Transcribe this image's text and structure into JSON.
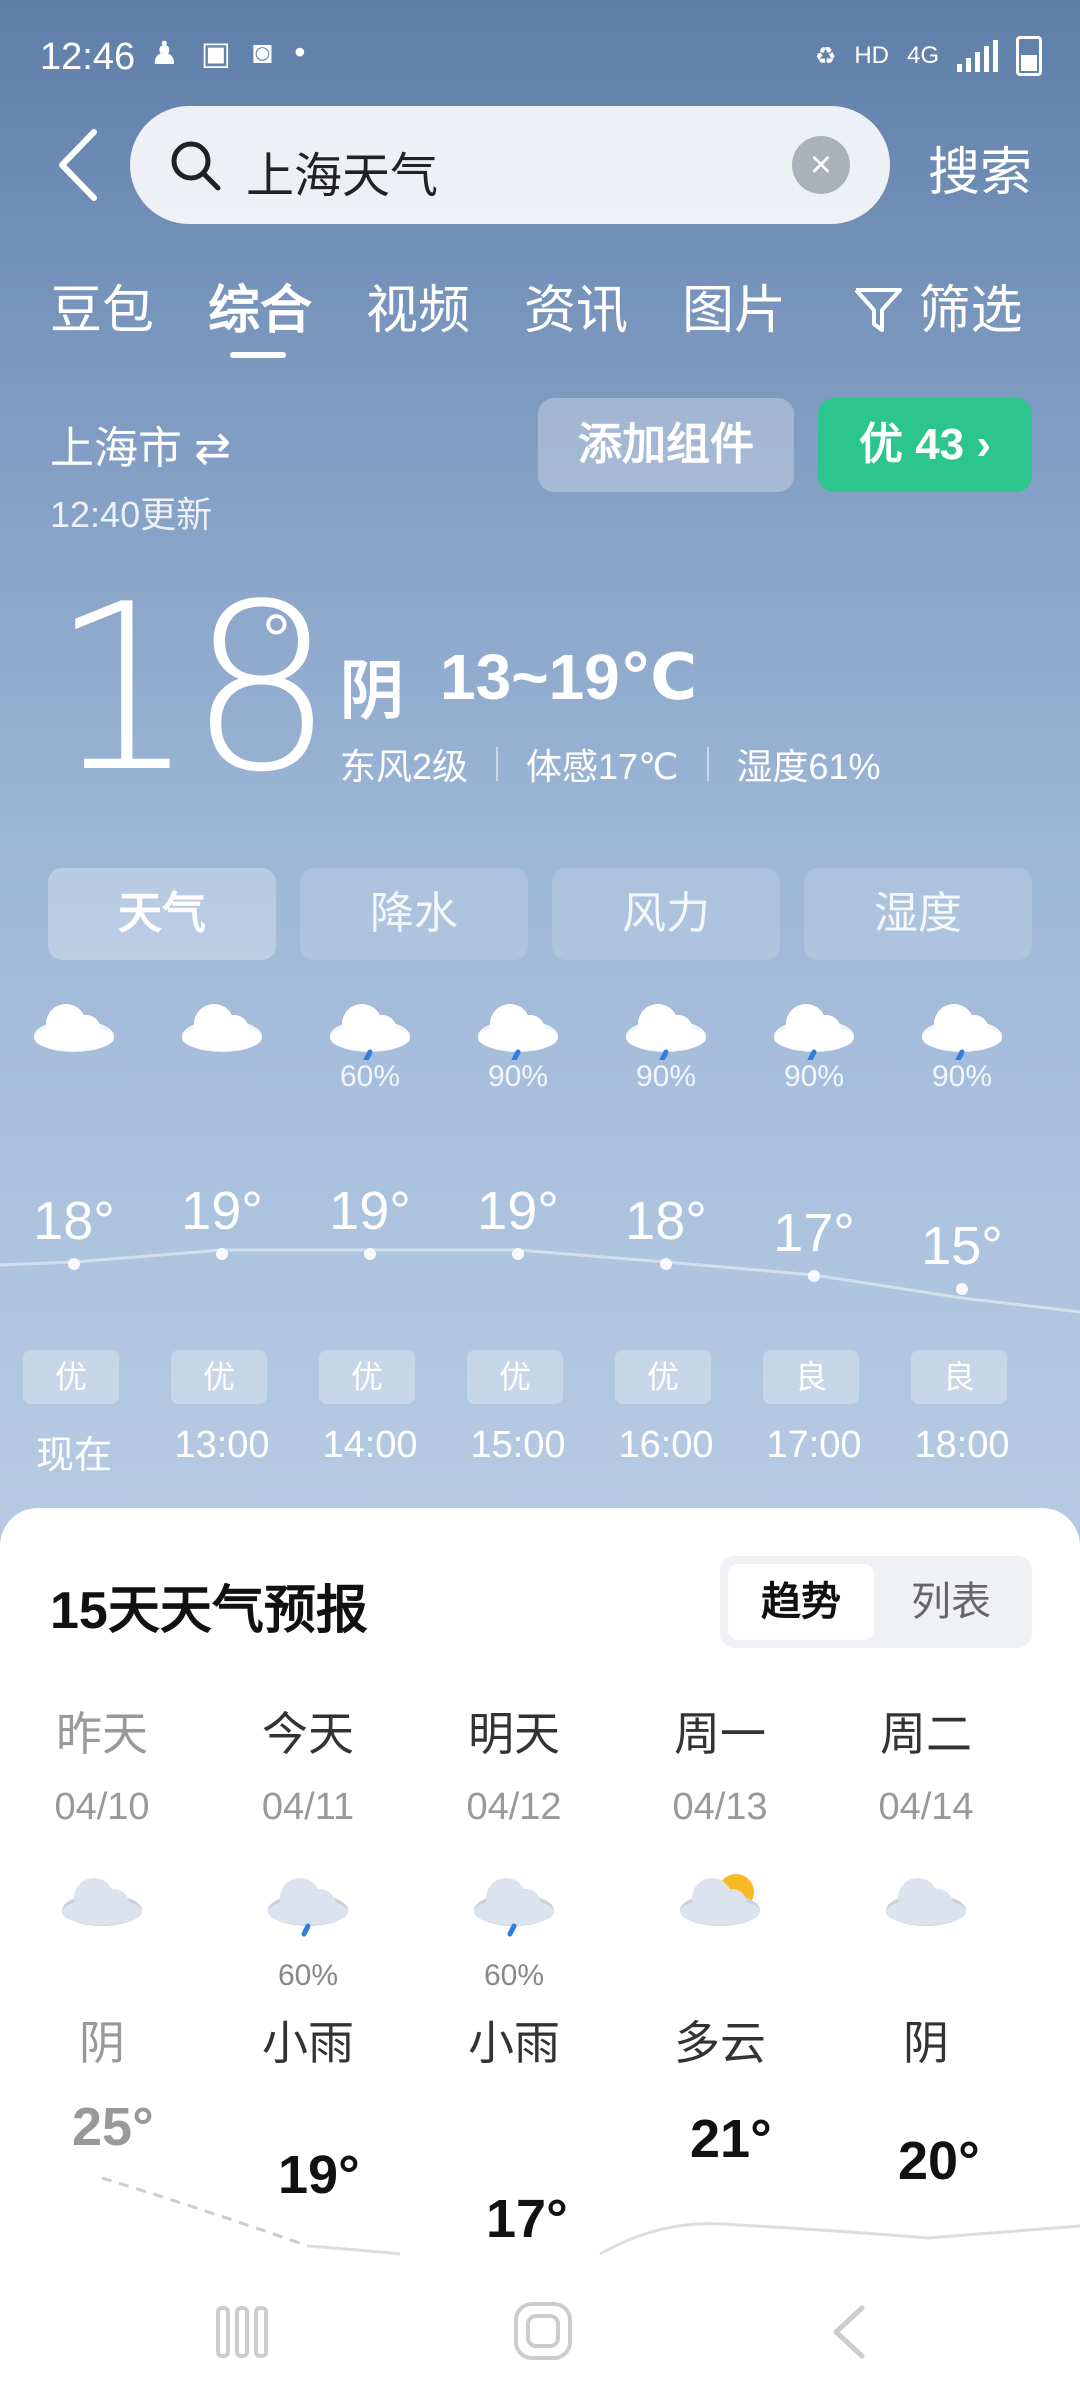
{
  "status": {
    "time": "12:46",
    "hd": "HD",
    "net": "4G"
  },
  "search": {
    "query": "上海天气",
    "button": "搜索",
    "clear": "×"
  },
  "tabs": [
    {
      "label": "豆包"
    },
    {
      "label": "综合"
    },
    {
      "label": "视频"
    },
    {
      "label": "资讯"
    },
    {
      "label": "图片"
    },
    {
      "label": "筛选"
    }
  ],
  "location": {
    "city": "上海市 ⇄",
    "update": "12:40更新"
  },
  "actions": {
    "widget": "添加组件",
    "aqi": "优 43 ›"
  },
  "current": {
    "temp": "18",
    "deg": "°",
    "condition": "阴",
    "range": "13~19℃",
    "wind": "东风2级",
    "feels": "体感17℃",
    "humidity": "湿度61%"
  },
  "metric_tabs": [
    {
      "label": "天气"
    },
    {
      "label": "降水"
    },
    {
      "label": "风力"
    },
    {
      "label": "湿度"
    }
  ],
  "hourly": [
    {
      "time": "现在",
      "temp": "18°",
      "pct": "",
      "aqi": "优",
      "icon": "cloud-icon"
    },
    {
      "time": "13:00",
      "temp": "19°",
      "pct": "",
      "aqi": "优",
      "icon": "cloud-icon"
    },
    {
      "time": "14:00",
      "temp": "19°",
      "pct": "60%",
      "aqi": "优",
      "icon": "rain-cloud-icon"
    },
    {
      "time": "15:00",
      "temp": "19°",
      "pct": "90%",
      "aqi": "优",
      "icon": "rain-cloud-icon"
    },
    {
      "time": "16:00",
      "temp": "18°",
      "pct": "90%",
      "aqi": "优",
      "icon": "rain-cloud-icon"
    },
    {
      "time": "17:00",
      "temp": "17°",
      "pct": "90%",
      "aqi": "良",
      "icon": "rain-cloud-icon"
    },
    {
      "time": "18:00",
      "temp": "15°",
      "pct": "90%",
      "aqi": "良",
      "icon": "rain-cloud-icon"
    }
  ],
  "forecast": {
    "title": "15天天气预报",
    "seg": {
      "trend": "趋势",
      "list": "列表"
    },
    "days": [
      {
        "name": "昨天",
        "date": "04/10",
        "pct": "",
        "cond": "阴",
        "high": "25°",
        "icon": "cloud-icon"
      },
      {
        "name": "今天",
        "date": "04/11",
        "pct": "60%",
        "cond": "小雨",
        "high": "19°",
        "icon": "rain-cloud-icon"
      },
      {
        "name": "明天",
        "date": "04/12",
        "pct": "60%",
        "cond": "小雨",
        "high": "17°",
        "icon": "rain-cloud-icon"
      },
      {
        "name": "周一",
        "date": "04/13",
        "pct": "",
        "cond": "多云",
        "high": "21°",
        "icon": "partly-cloudy-icon"
      },
      {
        "name": "周二",
        "date": "04/14",
        "pct": "",
        "cond": "阴",
        "high": "20°",
        "icon": "cloud-icon"
      }
    ]
  }
}
